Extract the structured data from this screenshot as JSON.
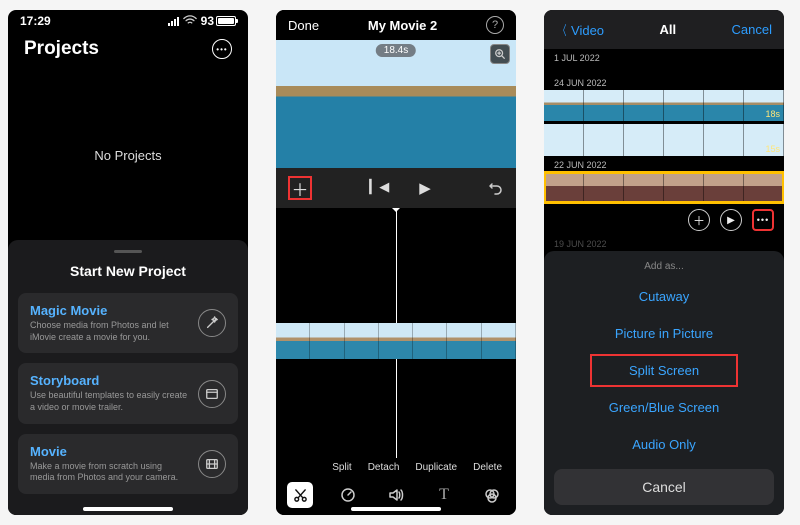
{
  "status": {
    "time": "17:29",
    "battery": "93"
  },
  "p1": {
    "title": "Projects",
    "empty": "No Projects",
    "sheet_title": "Start New Project",
    "cards": [
      {
        "title": "Magic Movie",
        "sub": "Choose media from Photos and let iMovie create a movie for you."
      },
      {
        "title": "Storyboard",
        "sub": "Use beautiful templates to easily create a video or movie trailer."
      },
      {
        "title": "Movie",
        "sub": "Make a movie from scratch using media from Photos and your camera."
      }
    ]
  },
  "p2": {
    "done": "Done",
    "title": "My Movie 2",
    "duration": "18.4s",
    "actions": [
      "Split",
      "Detach",
      "Duplicate",
      "Delete"
    ]
  },
  "p3": {
    "back": "Video",
    "seg": "All",
    "cancel_top": "Cancel",
    "dates": [
      "1 JUL 2022",
      "24 JUN 2022",
      "22 JUN 2022",
      "19 JUN 2022"
    ],
    "durs": [
      "18s",
      "15s"
    ],
    "addas_title": "Add as...",
    "options": [
      "Cutaway",
      "Picture in Picture",
      "Split Screen",
      "Green/Blue Screen",
      "Audio Only"
    ],
    "cancel": "Cancel"
  }
}
